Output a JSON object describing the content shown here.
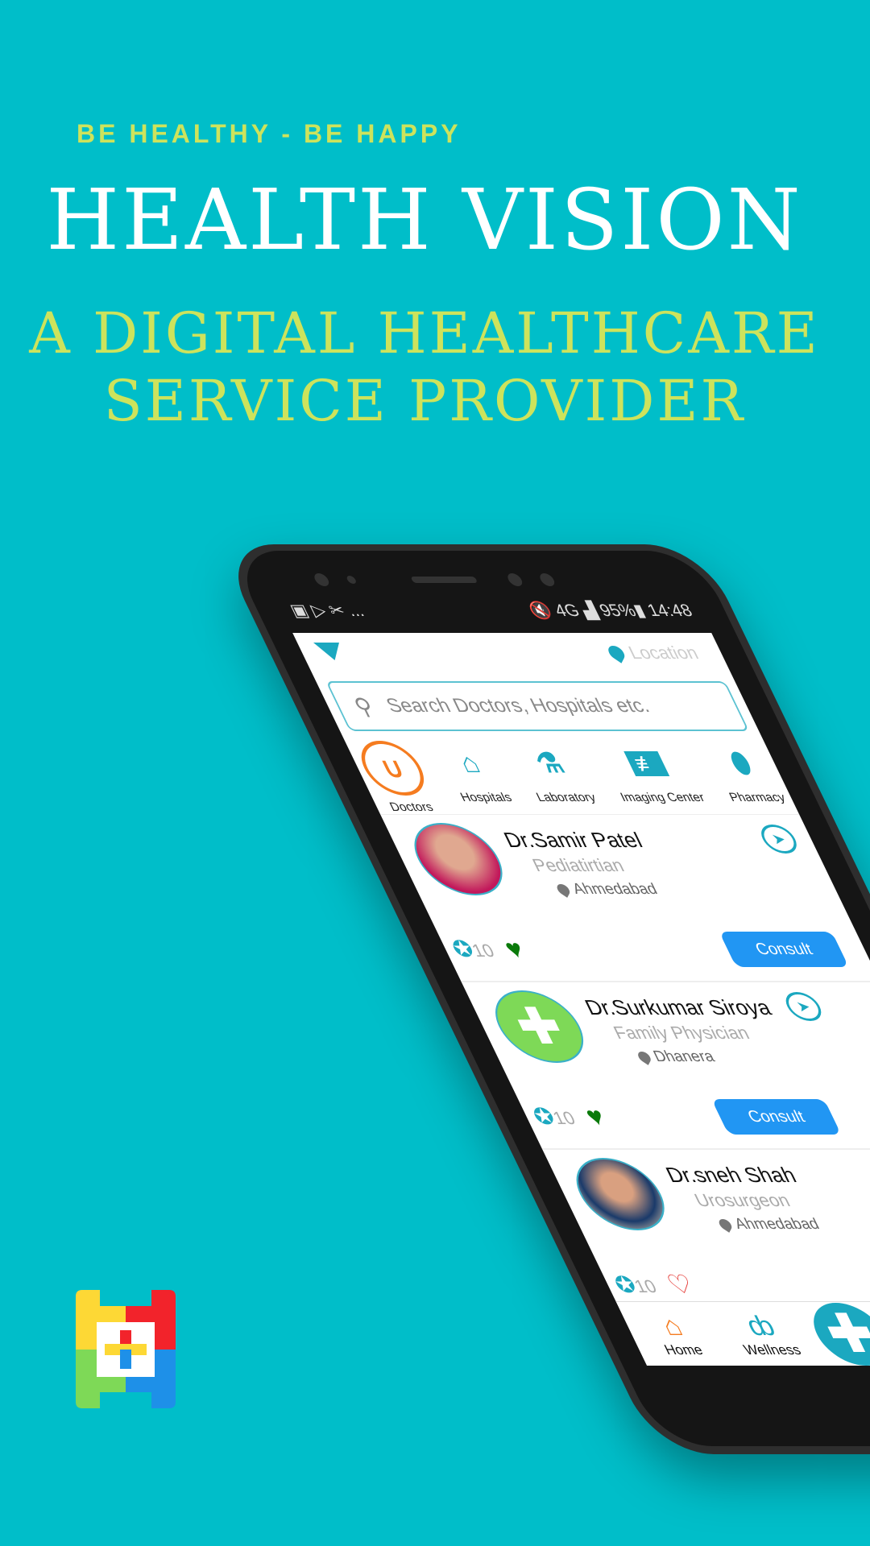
{
  "hero": {
    "tagline": "BE HEALTHY - BE HAPPY",
    "title": "HEALTH VISION",
    "subtitle_line1": "A DIGITAL HEALTHCARE",
    "subtitle_line2": "SERVICE PROVIDER"
  },
  "colors": {
    "background": "#00bec9",
    "accent_yellow": "#cde35c",
    "teal": "#1ba8c0",
    "orange": "#f57c20",
    "consult_blue": "#2196f3",
    "heart_green": "#0a7a0a"
  },
  "status_bar": {
    "left_icons": [
      "image-icon",
      "play-store-icon",
      "missed-call-icon",
      "more-icon"
    ],
    "more": "...",
    "network": "4G",
    "battery": "95%",
    "time": "14:48"
  },
  "app": {
    "location_label": "Location",
    "search_placeholder": "Search Doctors, Hospitals etc.",
    "categories": [
      {
        "label": "Doctors",
        "icon": "stethoscope-icon",
        "selected": true
      },
      {
        "label": "Hospitals",
        "icon": "hospital-icon"
      },
      {
        "label": "Laboratory",
        "icon": "test-tube-icon"
      },
      {
        "label": "Imaging Center",
        "icon": "xray-icon"
      },
      {
        "label": "Pharmacy",
        "icon": "pill-icon"
      }
    ],
    "doctors": [
      {
        "name": "Dr.Samir Patel",
        "specialty": "Pediatirtian",
        "city": "Ahmedabad",
        "awards": "10",
        "consult": "Consult"
      },
      {
        "name": "Dr.Surkumar Siroya",
        "specialty": "Family Physician",
        "city": "Dhanera",
        "awards": "10",
        "consult": "Consult"
      },
      {
        "name": "Dr.sneh Shah",
        "specialty": "Urosurgeon",
        "city": "Ahmedabad",
        "awards": "10",
        "consult": "Consult"
      }
    ],
    "bottom_nav": [
      {
        "label": "Home",
        "icon": "home-icon"
      },
      {
        "label": "Wellness",
        "icon": "bicycle-icon"
      }
    ]
  }
}
